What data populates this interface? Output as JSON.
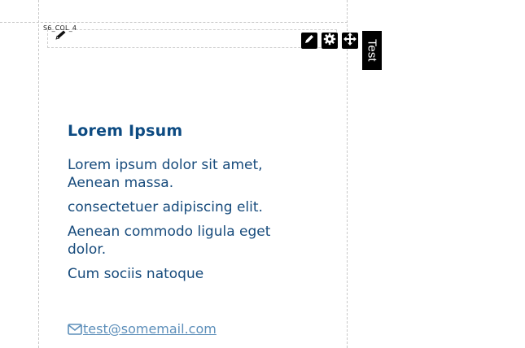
{
  "column": {
    "label": "S6_COL_4"
  },
  "toolbar": {
    "edit_icon": "pencil-icon",
    "settings_icon": "gear-icon",
    "move_icon": "move-arrows-icon"
  },
  "side_tab": {
    "label": "Test"
  },
  "content": {
    "heading": "Lorem Ipsum",
    "paragraphs": [
      "Lorem ipsum dolor sit amet, Aenean massa.",
      "consectetuer adipiscing elit.",
      "Aenean commodo ligula eget dolor.",
      "Cum sociis natoque"
    ],
    "email_icon": "envelope-icon",
    "email": "test@somemail.com"
  },
  "colors": {
    "heading": "#0d4b82",
    "text": "#174b7c",
    "link": "#5d8fba",
    "toolbar_bg": "#000000"
  }
}
